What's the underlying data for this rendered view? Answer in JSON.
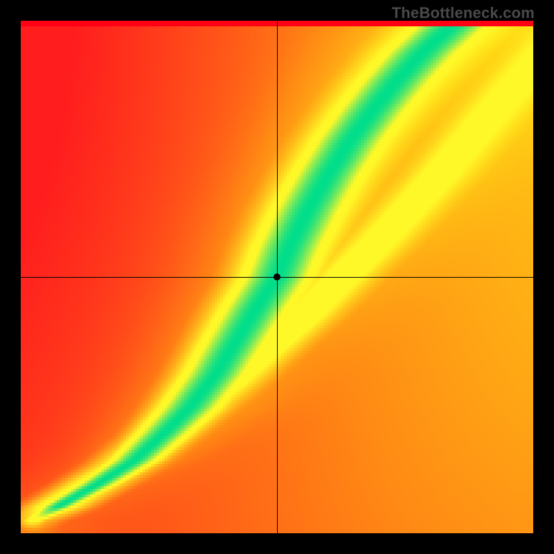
{
  "watermark": "TheBottleneck.com",
  "chart_data": {
    "type": "heatmap",
    "title": "",
    "xlabel": "",
    "ylabel": "",
    "xlim": [
      0,
      1
    ],
    "ylim": [
      0,
      1
    ],
    "crosshair": {
      "x": 0.5,
      "y": 0.5
    },
    "marker": {
      "x": 0.5,
      "y": 0.5,
      "radius": 5
    },
    "colorscale": [
      "#ff1a1a",
      "#ff7a1a",
      "#ffd11a",
      "#fff81a",
      "#00e08a"
    ],
    "ridge_points": [
      {
        "x": 0.02,
        "y": 0.02,
        "width": 0.02
      },
      {
        "x": 0.08,
        "y": 0.055,
        "width": 0.025
      },
      {
        "x": 0.15,
        "y": 0.095,
        "width": 0.03
      },
      {
        "x": 0.22,
        "y": 0.14,
        "width": 0.035
      },
      {
        "x": 0.28,
        "y": 0.195,
        "width": 0.04
      },
      {
        "x": 0.33,
        "y": 0.245,
        "width": 0.045
      },
      {
        "x": 0.38,
        "y": 0.31,
        "width": 0.048
      },
      {
        "x": 0.42,
        "y": 0.375,
        "width": 0.05
      },
      {
        "x": 0.46,
        "y": 0.44,
        "width": 0.052
      },
      {
        "x": 0.5,
        "y": 0.5,
        "width": 0.053
      },
      {
        "x": 0.525,
        "y": 0.56,
        "width": 0.054
      },
      {
        "x": 0.56,
        "y": 0.63,
        "width": 0.055
      },
      {
        "x": 0.6,
        "y": 0.7,
        "width": 0.055
      },
      {
        "x": 0.645,
        "y": 0.77,
        "width": 0.056
      },
      {
        "x": 0.69,
        "y": 0.83,
        "width": 0.057
      },
      {
        "x": 0.735,
        "y": 0.885,
        "width": 0.058
      },
      {
        "x": 0.785,
        "y": 0.94,
        "width": 0.059
      },
      {
        "x": 0.84,
        "y": 0.99,
        "width": 0.06
      }
    ],
    "secondary_ridge_points": [
      {
        "x": 0.02,
        "y": 0.02
      },
      {
        "x": 0.2,
        "y": 0.13
      },
      {
        "x": 0.4,
        "y": 0.29
      },
      {
        "x": 0.55,
        "y": 0.42
      },
      {
        "x": 0.7,
        "y": 0.57
      },
      {
        "x": 0.82,
        "y": 0.7
      },
      {
        "x": 0.92,
        "y": 0.82
      },
      {
        "x": 0.99,
        "y": 0.9
      }
    ],
    "secondary_ridge_width": 0.045,
    "heat_lobe": {
      "cx": 0.97,
      "cy": 0.97,
      "strength": 1.0,
      "sigma": 0.95
    },
    "cold_lobe": {
      "cx": 0.0,
      "cy": 1.0,
      "strength": 1.0,
      "sigma": 0.75
    },
    "resolution": 185
  }
}
